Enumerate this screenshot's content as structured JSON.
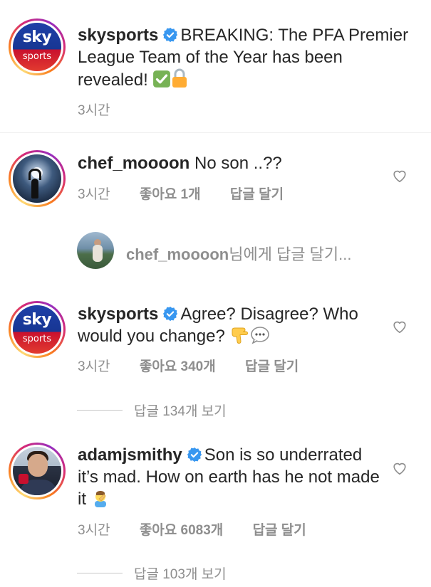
{
  "post_caption": {
    "username": "skysports",
    "avatar_top": "sky",
    "avatar_bottom": "sports",
    "text": "BREAKING: The PFA Premier League Team of the Year has been revealed!",
    "time": "3시간"
  },
  "comments": [
    {
      "username": "chef_moooon",
      "text": "No son ..??",
      "time": "3시간",
      "likes": "좋아요 1개",
      "reply_label": "답글 달기"
    },
    {
      "username": "skysports",
      "avatar_top": "sky",
      "avatar_bottom": "sports",
      "text": "Agree? Disagree? Who would you change?",
      "time": "3시간",
      "likes": "좋아요 340개",
      "reply_label": "답글 달기",
      "view_replies": "답글 134개 보기"
    },
    {
      "username": "adamjsmithy",
      "text": "Son is so underrated it’s mad. How on earth has he not made it",
      "time": "3시간",
      "likes": "좋아요 6083개",
      "reply_label": "답글 달기",
      "view_replies": "답글 103개 보기"
    }
  ],
  "reply_prompt": {
    "target": "chef_moooon",
    "suffix": "님에게 답글 달기..."
  },
  "colors": {
    "verified": "#3897f0",
    "secondary_text": "#8e8e8e",
    "primary_text": "#262626"
  },
  "icons": [
    "verified-badge-icon",
    "check-mark-emoji-icon",
    "lock-emoji-icon",
    "pointing-down-emoji-icon",
    "speech-bubble-emoji-icon",
    "facepalm-emoji-icon",
    "heart-icon"
  ]
}
